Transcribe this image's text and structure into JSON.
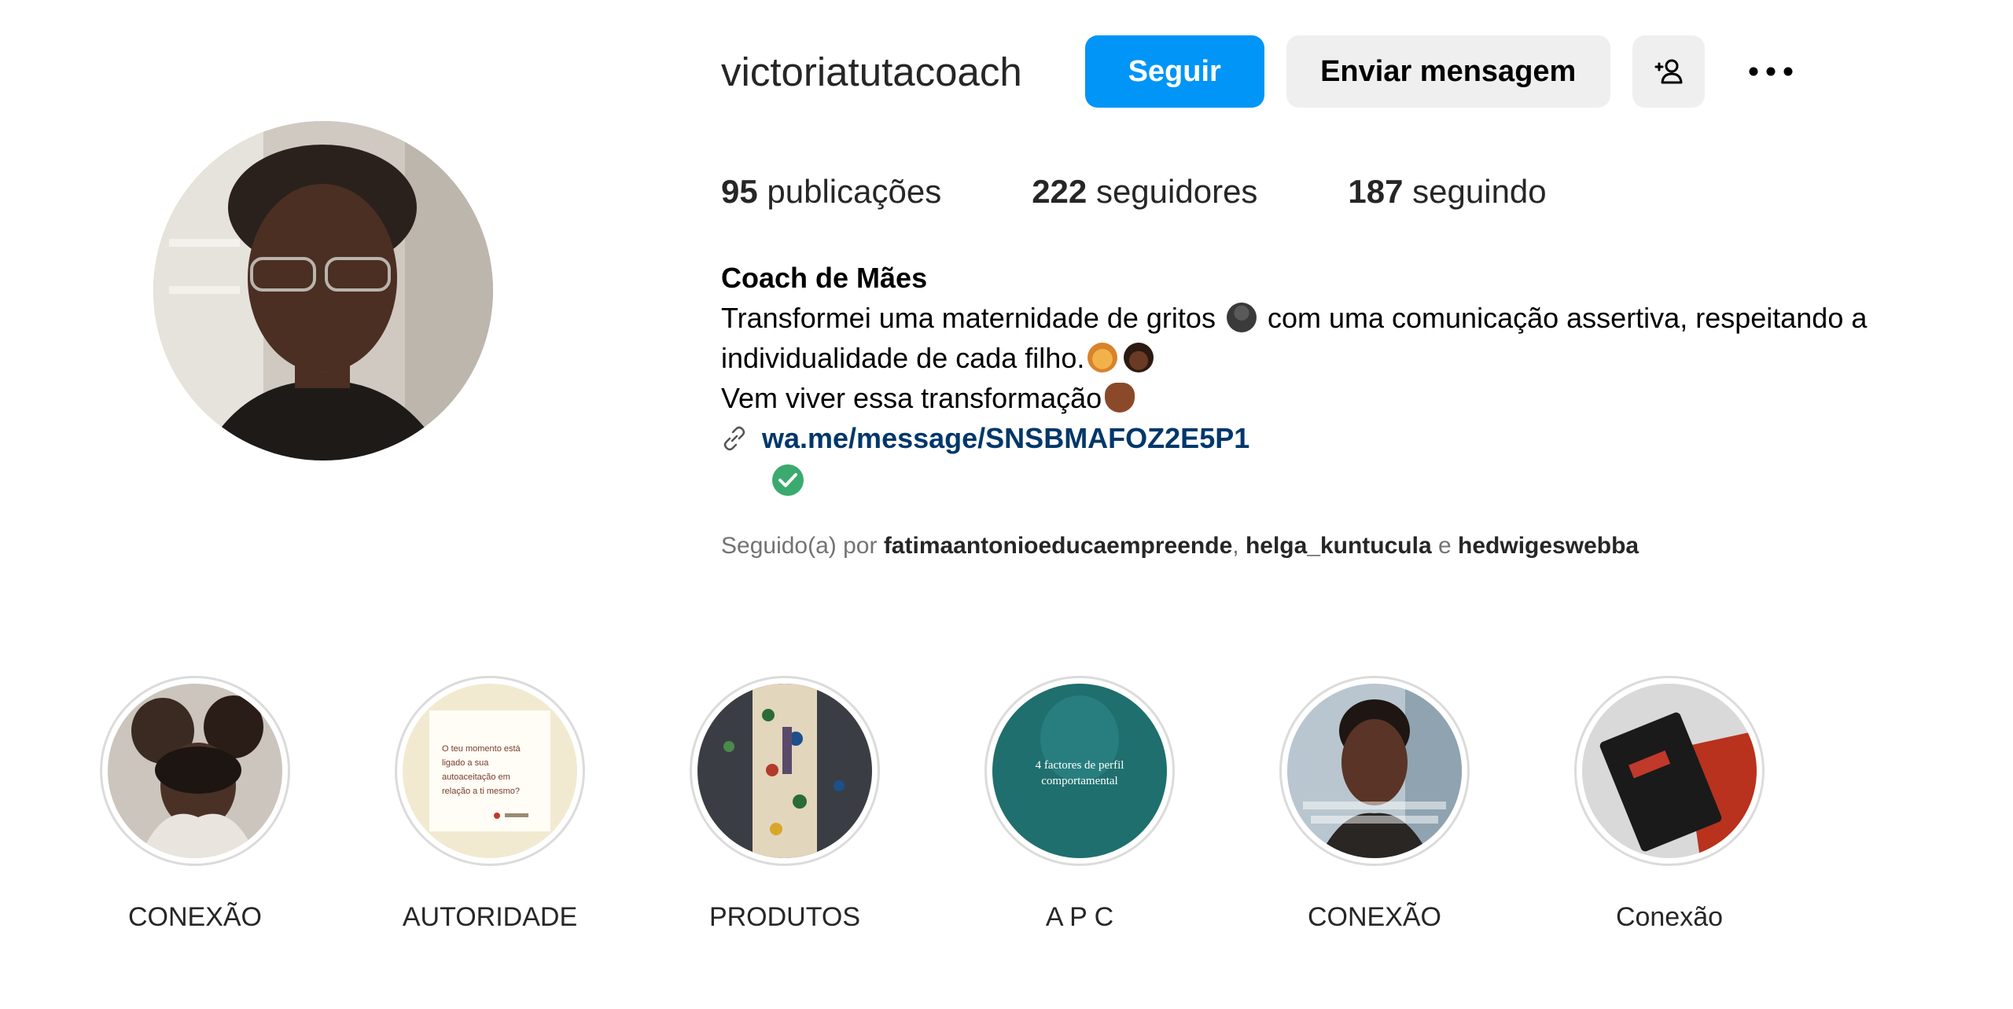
{
  "profile": {
    "username": "victoriatutacoach",
    "follow_label": "Seguir",
    "message_label": "Enviar mensagem",
    "add_user_icon": "add-person-icon",
    "more_icon": "more-horizontal-icon"
  },
  "stats": {
    "posts_count": "95",
    "posts_label": "publicações",
    "followers_count": "222",
    "followers_label": "seguidores",
    "following_count": "187",
    "following_label": "seguindo"
  },
  "bio": {
    "name": "Coach de Mães",
    "line1_a": "Transformei uma maternidade de gritos",
    "line1_b": "com uma comunicação assertiva, respeitando a",
    "line2": "individualidade de cada filho.",
    "line3": "Vem viver essa transformação",
    "link": "wa.me/message/SNSBMAFOZ2E5P1"
  },
  "followed_by": {
    "prefix": "Seguido(a) por",
    "user1": "fatimaantonioeducaempreende",
    "separator": ",",
    "user2": "helga_kuntucula",
    "conjunction": "e",
    "user3": "hedwigeswebba"
  },
  "highlights": [
    {
      "label": "CONEXÃO"
    },
    {
      "label": "AUTORIDADE",
      "cover_line1": "O teu momento está",
      "cover_line2": "ligado a sua",
      "cover_line3": "autoaceitação em",
      "cover_line4": "relação a ti mesmo?"
    },
    {
      "label": "PRODUTOS"
    },
    {
      "label": "A P C",
      "cover_line1": "4 factores de perfil",
      "cover_line2": "comportamental"
    },
    {
      "label": "CONEXÃO"
    },
    {
      "label": "Conexão"
    }
  ],
  "colors": {
    "accent": "#0095f6",
    "secondary_button": "#efefef",
    "link": "#00376b",
    "verified": "#3aaa6e",
    "muted_text": "#737373"
  }
}
